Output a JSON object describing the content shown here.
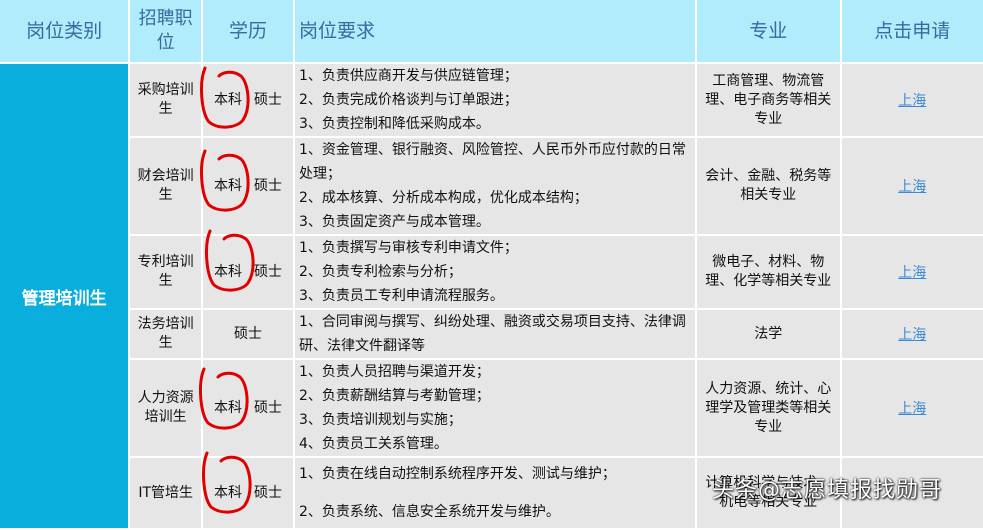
{
  "header": [
    "岗位类别",
    "招聘职位",
    "学历",
    "岗位要求",
    "专业",
    "点击申请"
  ],
  "category": "管理培训生",
  "rows": [
    {
      "position": "采购培训生",
      "edu": [
        "本科",
        "硕士"
      ],
      "req": [
        "1、负责供应商开发与供应链管理；",
        "2、负责完成价格谈判与订单跟进；",
        "3、负责控制和降低采购成本。"
      ],
      "major": "工商管理、物流管理、电子商务等相关专业",
      "apply": "上海"
    },
    {
      "position": "财会培训生",
      "edu": [
        "本科",
        "硕士"
      ],
      "req": [
        "1、资金管理、银行融资、风险管控、人民币外币应付款的日常处理；",
        "2、成本核算、分析成本构成，优化成本结构；",
        "3、负责固定资产与成本管理。"
      ],
      "major": "会计、金融、税务等相关专业",
      "apply": "上海"
    },
    {
      "position": "专利培训生",
      "edu": [
        "本科",
        "硕士"
      ],
      "req": [
        "1、负责撰写与审核专利申请文件；",
        "2、负责专利检索与分析；",
        "3、负责员工专利申请流程服务。"
      ],
      "major": "微电子、材料、物理、化学等相关专业",
      "apply": "上海"
    },
    {
      "position": "法务培训生",
      "edu": [
        "",
        "硕士"
      ],
      "req": [
        "1、合同审阅与撰写、纠纷处理、融资或交易项目支持、法律调研、法律文件翻译等"
      ],
      "major": "法学",
      "apply": "上海"
    },
    {
      "position": "人力资源培训生",
      "edu": [
        "本科",
        "硕士"
      ],
      "req": [
        "1、负责人员招聘与渠道开发；",
        "2、负责薪酬结算与考勤管理；",
        "3、负责培训规划与实施；",
        "4、负责员工关系管理。"
      ],
      "major": "人力资源、统计、心理学及管理类等相关专业",
      "apply": "上海"
    },
    {
      "position": "IT管培生",
      "edu": [
        "本科",
        "硕士"
      ],
      "req": [
        "1、负责在线自动控制系统程序开发、测试与维护；",
        "2、负责系统、信息安全系统开发与维护。"
      ],
      "major": "计算机科学与技术、机电等相关专业",
      "apply": ""
    }
  ],
  "watermark": "头条@志愿填报找勋哥",
  "colors": {
    "header_bg": "#b0ecfb",
    "category_bg": "#0aaedc",
    "cell_bg": "#e6e6e6",
    "link": "#3a8ad8",
    "annotation": "#e00000"
  }
}
